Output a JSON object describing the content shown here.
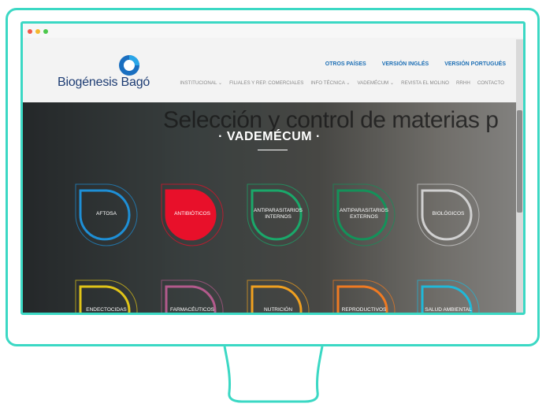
{
  "site": {
    "logo_text": "Biogénesis Bagó",
    "top_links": [
      "OTROS PAÍSES",
      "VERSIÓN INGLÉS",
      "VERSIÓN PORTUGUÉS"
    ],
    "nav": [
      "INSTITUCIONAL ⌄",
      "FILIALES Y REP. COMERCIALES",
      "INFO TÉCNICA ⌄",
      "VADEMÉCUM ⌄",
      "REVISTA EL MOLINO",
      "RRHH",
      "CONTACTO"
    ]
  },
  "hero": {
    "banner": "Selección y control de materias p",
    "title": "· VADEMÉCUM ·"
  },
  "categories": [
    {
      "label": "AFTOSA",
      "color": "#1e8fd6",
      "filled": false
    },
    {
      "label": "ANTIBIÓTICOS",
      "color": "#e8102a",
      "filled": true
    },
    {
      "label": "ANTIPARASITARIOS INTERNOS",
      "color": "#1aa86a",
      "filled": false
    },
    {
      "label": "ANTIPARASITARIOS EXTERNOS",
      "color": "#14925a",
      "filled": false
    },
    {
      "label": "BIOLÓGICOS",
      "color": "#d0d0d0",
      "filled": false
    },
    {
      "label": "ENDECTOCIDAS",
      "color": "#e0c418",
      "filled": false
    },
    {
      "label": "FARMACÉUTICOS",
      "color": "#b35a8c",
      "filled": false
    },
    {
      "label": "NUTRICIÓN",
      "color": "#f0a020",
      "filled": false
    },
    {
      "label": "REPRODUCTIVOS",
      "color": "#f07a22",
      "filled": false
    },
    {
      "label": "SALUD AMBIENTAL",
      "color": "#20b8d8",
      "filled": false
    }
  ],
  "colors": {
    "frame": "#3bd8c4",
    "brand_blue": "#1d3c73",
    "link_blue": "#1d6fb5"
  }
}
